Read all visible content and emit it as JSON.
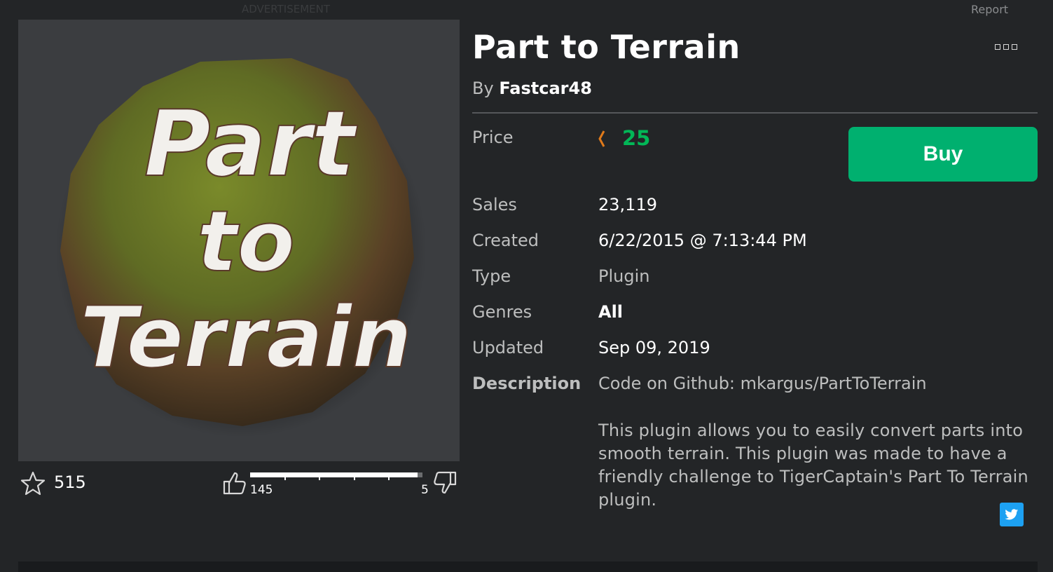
{
  "ad_label": "ADVERTISEMENT",
  "report_label": "Report",
  "thumbnail": {
    "text_lines": [
      "Part",
      "to",
      "Terrain"
    ]
  },
  "favorites": {
    "count": "515",
    "icon": "star-icon"
  },
  "votes": {
    "up_count": "145",
    "down_count": "5",
    "up_ratio": 0.97,
    "up_icon": "thumbs-up-icon",
    "down_icon": "thumbs-down-icon"
  },
  "item": {
    "title": "Part to Terrain",
    "by_prefix": "By",
    "creator": "Fastcar48",
    "more_icon": "more-options-icon"
  },
  "price": {
    "label": "Price",
    "amount": "25",
    "currency_icon": "robux-icon",
    "color": "#02b757"
  },
  "buy_button": {
    "label": "Buy",
    "color": "#00b06f"
  },
  "details": {
    "sales_label": "Sales",
    "sales_value": "23,119",
    "created_label": "Created",
    "created_value": "6/22/2015 @ 7:13:44 PM",
    "type_label": "Type",
    "type_value": "Plugin",
    "genres_label": "Genres",
    "genres_value": "All",
    "updated_label": "Updated",
    "updated_value": "Sep 09, 2019",
    "description_label": "Description",
    "description_line1": "Code on Github: mkargus/PartToTerrain",
    "description_body": "This plugin allows you to easily convert parts into smooth terrain. This plugin was made to have a friendly challenge to TigerCaptain's Part To Terrain plugin."
  },
  "share": {
    "icon": "twitter-icon",
    "color": "#1da1f2"
  }
}
